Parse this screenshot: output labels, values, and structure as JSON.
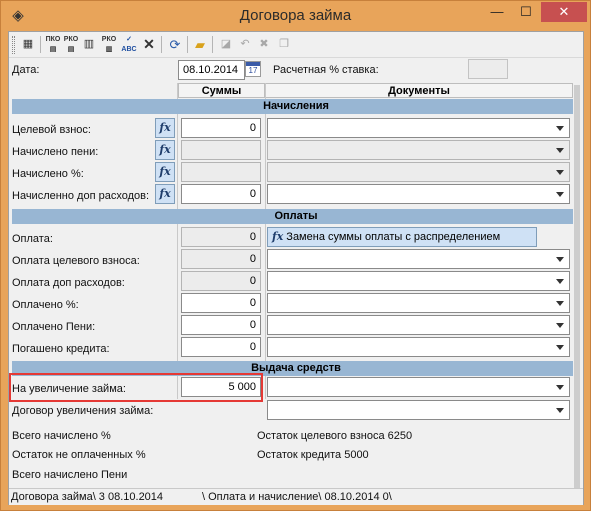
{
  "window": {
    "title": "Договора займа",
    "icon": "diamond-app-icon",
    "controls": {
      "minimize": "—",
      "maximize": "☐",
      "close": "✕"
    }
  },
  "toolbar": {
    "icons": [
      "print-icon",
      "record-pko-icon",
      "record-rko-icon",
      "pko-doc-icon",
      "rko-doc-icon",
      "spellcheck-icon",
      "delete-icon",
      "refresh-icon",
      "open-folder-icon",
      "eraser-icon",
      "undo-icon",
      "cancel-icon",
      "copy-icon"
    ]
  },
  "header": {
    "date_label": "Дата:",
    "date_value": "08.10.2014",
    "rate_label": "Расчетная % ставка:",
    "rate_value": ""
  },
  "columns": {
    "sums": "Суммы",
    "docs": "Документы"
  },
  "sections": {
    "accruals": {
      "title": "Начисления",
      "rows": [
        {
          "label": "Целевой взнос:",
          "value": "0",
          "readonly": false,
          "has_fx": true,
          "combo_readonly": false
        },
        {
          "label": "Начислено пени:",
          "value": "",
          "readonly": true,
          "has_fx": true,
          "combo_readonly": true
        },
        {
          "label": "Начислено %:",
          "value": "",
          "readonly": true,
          "has_fx": true,
          "combo_readonly": true
        },
        {
          "label": "Начисленно доп расходов:",
          "value": "0",
          "readonly": false,
          "has_fx": true,
          "combo_readonly": false
        }
      ]
    },
    "payments": {
      "title": "Оплаты",
      "rows": [
        {
          "label": "Оплата:",
          "value": "0",
          "readonly": true
        },
        {
          "label": "Оплата целевого взноса:",
          "value": "0",
          "readonly": true
        },
        {
          "label": "Оплата доп расходов:",
          "value": "0",
          "readonly": true
        },
        {
          "label": "Оплачено %:",
          "value": "0",
          "readonly": false
        },
        {
          "label": "Оплачено Пени:",
          "value": "0",
          "readonly": false
        },
        {
          "label": "Погашено кредита:",
          "value": "0",
          "readonly": false
        }
      ],
      "replace_button": "Замена суммы оплаты с распределением"
    },
    "disbursement": {
      "title": "Выдача средств",
      "increase_label": "На увеличение займа:",
      "increase_value": "5 000",
      "contract_label": "Договор увеличения займа:"
    }
  },
  "summary": {
    "total_accrued_percent": "Всего начислено %",
    "unpaid_percent_balance": "Остаток не оплаченных %",
    "total_accrued_penalty": "Всего начислено Пени",
    "target_fee_balance": "Остаток целевого взноса 6250",
    "credit_balance": "Остаток кредита 5000"
  },
  "statusbar": {
    "left": "Договора займа\\ 3 08.10.2014",
    "right": "\\ Оплата и начисление\\ 08.10.2014 0\\"
  },
  "colors": {
    "title_bar": "#e8a45a",
    "section_header": "#98b6d3",
    "fx_button": "#cfe1f5",
    "highlight": "#e53935"
  }
}
